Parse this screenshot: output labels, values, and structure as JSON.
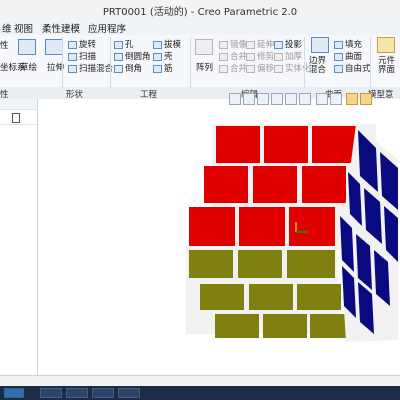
{
  "window": {
    "title": "PRT0001 (活动的) - Creo Parametric 2.0"
  },
  "tabs": [
    "维",
    "视图",
    "柔性建模",
    "应用程序"
  ],
  "ribbon": {
    "col1": [
      "性",
      "坐标系"
    ],
    "datum": {
      "label": "草绘"
    },
    "extrude": {
      "label": "拉伸"
    },
    "shape_items": [
      "旋转",
      "扫描",
      "扫描混合"
    ],
    "eng_items": [
      "孔",
      "倒圆角",
      "倒角"
    ],
    "eng_items2": [
      "拔模",
      "壳",
      "筋"
    ],
    "pattern": {
      "label": "阵列"
    },
    "edit_grid": [
      "镜像",
      "延伸",
      "投影",
      "合并",
      "修剪",
      "加厚",
      "合并",
      "偏移",
      "实体化"
    ],
    "surface": {
      "label": "边界混合",
      "items": [
        "填充",
        "曲面",
        "自由式"
      ]
    },
    "intent": {
      "label": "元件界面"
    }
  },
  "groups": [
    "性",
    "形状",
    "工程",
    "编辑",
    "曲面",
    "模型意图"
  ],
  "colors": {
    "front": "#e00000",
    "left": "#808010",
    "right": "#0a0a80",
    "bevel": "#f2f2f2"
  },
  "cube_palette": {
    "face": "red/olive/blue",
    "note": "3x3 puzzle cube in graphics area"
  }
}
